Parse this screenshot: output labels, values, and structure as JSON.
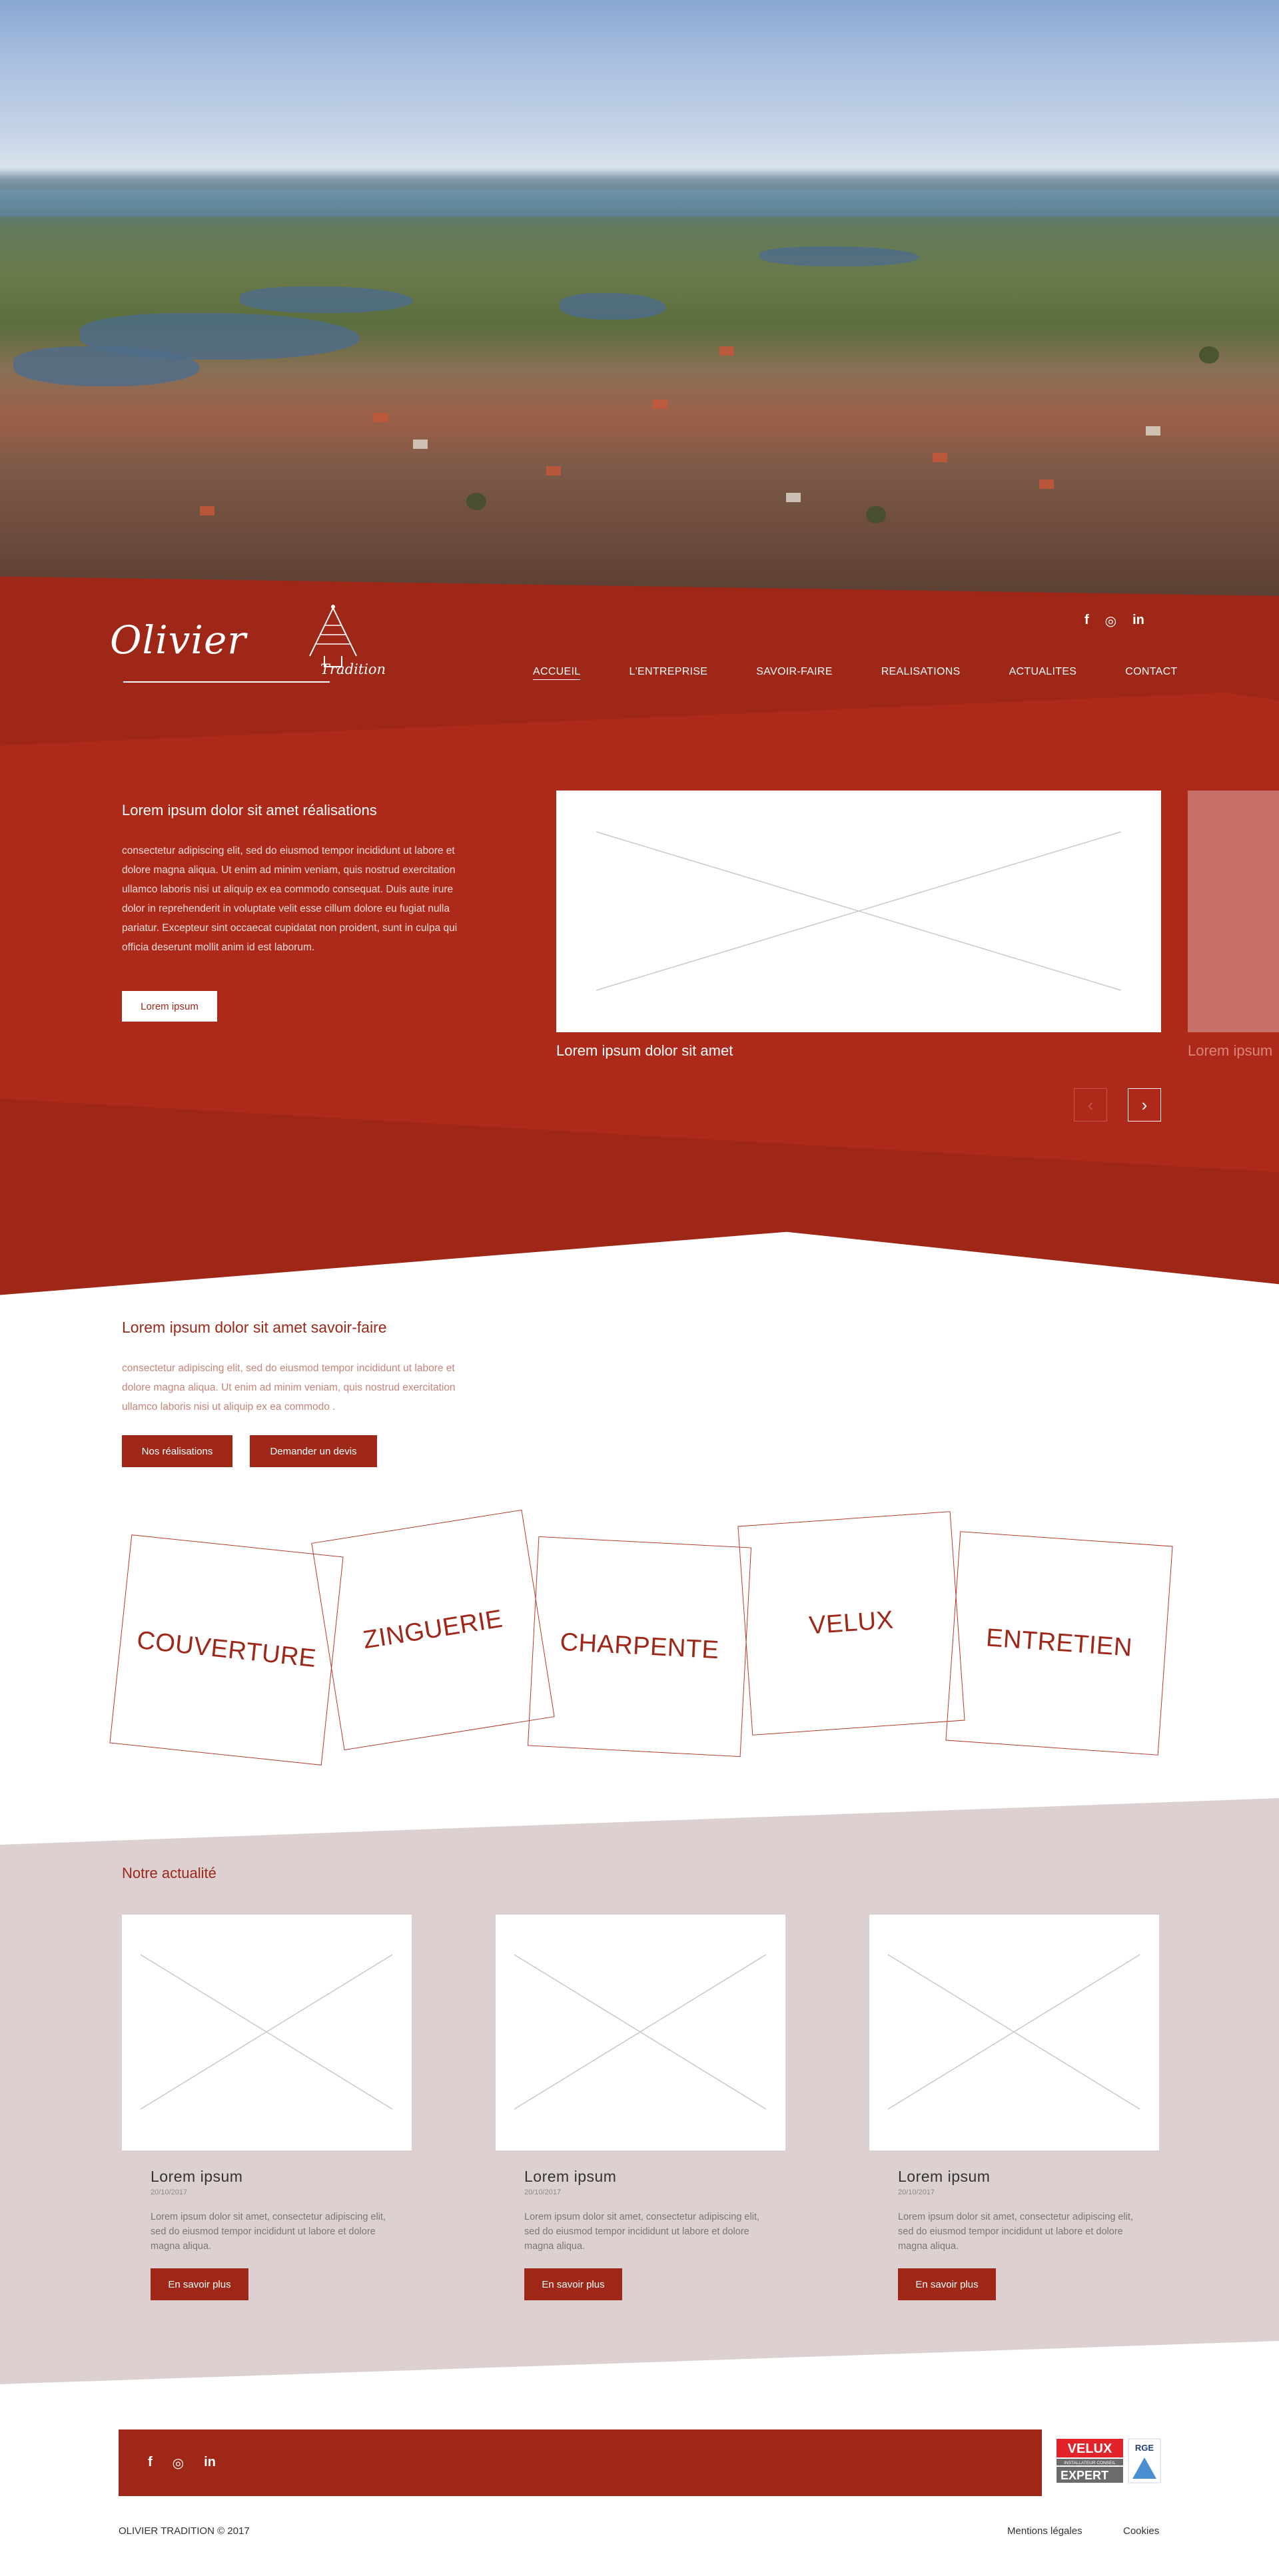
{
  "brand": {
    "logo_name": "Olivier",
    "logo_sub": "Tradition"
  },
  "social": {
    "facebook": "f",
    "instagram": "◎",
    "linkedin": "in"
  },
  "nav": [
    {
      "label": "ACCUEIL",
      "active": true
    },
    {
      "label": "L'ENTREPRISE",
      "active": false
    },
    {
      "label": "SAVOIR-FAIRE",
      "active": false
    },
    {
      "label": "REALISATIONS",
      "active": false
    },
    {
      "label": "ACTUALITES",
      "active": false
    },
    {
      "label": "CONTACT",
      "active": false
    }
  ],
  "realisations": {
    "title": "Lorem ipsum dolor sit amet réalisations",
    "body": "consectetur adipiscing elit, sed do eiusmod tempor incididunt ut labore et dolore magna aliqua. Ut enim ad minim veniam, quis nostrud exercitation ullamco laboris nisi ut aliquip ex ea commodo consequat. Duis aute irure dolor in reprehenderit in voluptate velit esse cillum dolore eu fugiat nulla pariatur. Excepteur sint occaecat cupidatat non proident, sunt in culpa qui officia deserunt mollit anim id est laborum.",
    "button": "Lorem ipsum",
    "slides": [
      {
        "caption": "Lorem ipsum dolor sit amet"
      },
      {
        "caption": "Lorem ipsum"
      }
    ],
    "prev_icon": "‹",
    "next_icon": "›"
  },
  "savoir_faire": {
    "title": "Lorem ipsum dolor sit amet savoir-faire",
    "body": "consectetur adipiscing elit, sed do eiusmod tempor incididunt ut labore et dolore magna aliqua. Ut enim ad minim veniam, quis nostrud exercitation ullamco laboris nisi ut aliquip ex ea commodo .",
    "btn_realisations": "Nos réalisations",
    "btn_devis": "Demander un devis",
    "tiles": [
      "COUVERTURE",
      "ZINGUERIE",
      "CHARPENTE",
      "VELUX",
      "ENTRETIEN"
    ]
  },
  "news": {
    "title": "Notre actualité",
    "cards": [
      {
        "title": "Lorem ipsum",
        "date": "20/10/2017",
        "body": "Lorem ipsum dolor sit amet, consectetur adipiscing elit, sed do eiusmod tempor incididunt ut labore et dolore magna aliqua.",
        "button": "En savoir plus"
      },
      {
        "title": "Lorem ipsum",
        "date": "20/10/2017",
        "body": "Lorem ipsum dolor sit amet, consectetur adipiscing elit, sed do eiusmod tempor incididunt ut labore et dolore magna aliqua.",
        "button": "En savoir plus"
      },
      {
        "title": "Lorem ipsum",
        "date": "20/10/2017",
        "body": "Lorem ipsum dolor sit amet, consectetur adipiscing elit, sed do eiusmod tempor incididunt ut labore et dolore magna aliqua.",
        "button": "En savoir plus"
      }
    ]
  },
  "footer": {
    "badge_brand": "VELUX",
    "badge_tag": "INSTALLATEUR CONSEIL",
    "badge_level": "EXPERT",
    "badge_rge": "RGE",
    "copyright": "OLIVIER TRADITION  © 2017",
    "links": [
      "Mentions légales",
      "Cookies"
    ]
  },
  "colors": {
    "brand_red": "#9e2718",
    "news_bg": "#ddd0d0"
  }
}
